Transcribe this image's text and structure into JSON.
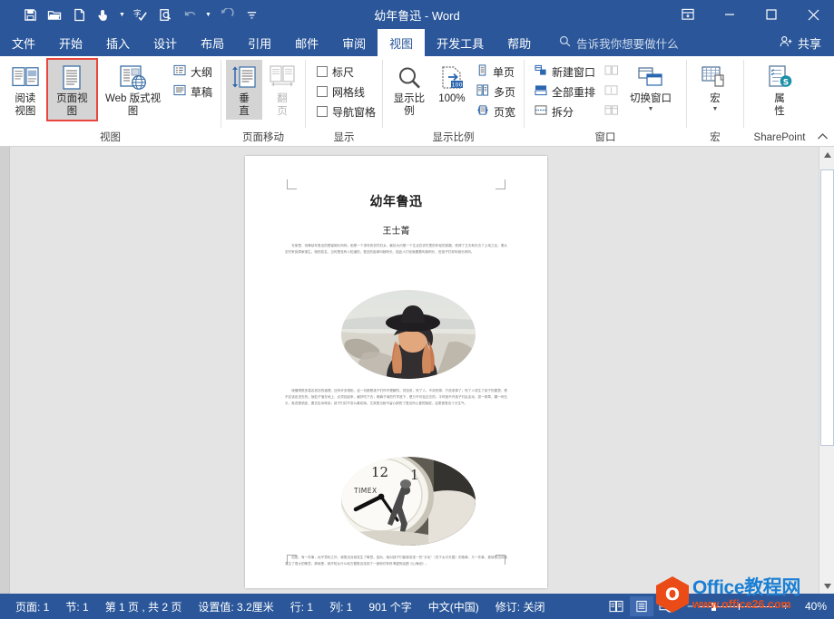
{
  "window": {
    "title": "幼年鲁迅  -  Word",
    "quick_access": [
      {
        "name": "save-icon",
        "label": "保存"
      },
      {
        "name": "open-icon",
        "label": "打开"
      },
      {
        "name": "new-document-icon",
        "label": "新建"
      },
      {
        "name": "touch-mode-icon",
        "label": "触摸/鼠标模式"
      },
      {
        "name": "spelling-check-icon",
        "label": "拼写和语法"
      },
      {
        "name": "print-preview-icon",
        "label": "打印预览和打印"
      },
      {
        "name": "undo-icon",
        "label": "撤消"
      },
      {
        "name": "redo-icon",
        "label": "恢复"
      },
      {
        "name": "customize-qat-icon",
        "label": "自定义快速访问工具栏"
      }
    ],
    "controls": [
      {
        "name": "ribbon-display-options-icon",
        "label": "功能区显示选项"
      },
      {
        "name": "minimize-icon",
        "label": "最小化"
      },
      {
        "name": "maximize-icon",
        "label": "最大化"
      },
      {
        "name": "close-icon",
        "label": "关闭"
      }
    ]
  },
  "tabs": [
    {
      "label": "文件",
      "active": false
    },
    {
      "label": "开始",
      "active": false
    },
    {
      "label": "插入",
      "active": false
    },
    {
      "label": "设计",
      "active": false
    },
    {
      "label": "布局",
      "active": false
    },
    {
      "label": "引用",
      "active": false
    },
    {
      "label": "邮件",
      "active": false
    },
    {
      "label": "审阅",
      "active": false
    },
    {
      "label": "视图",
      "active": true
    },
    {
      "label": "开发工具",
      "active": false
    },
    {
      "label": "帮助",
      "active": false
    }
  ],
  "tell_me": {
    "icon": "search-icon",
    "placeholder": "告诉我你想要做什么"
  },
  "share": {
    "icon": "share-person-icon",
    "label": "共享"
  },
  "ribbon": {
    "groups": [
      {
        "name": "视图",
        "label": "视图",
        "buttons": [
          {
            "label": "阅读\n视图",
            "label_l1": "阅读",
            "label_l2": "视图",
            "icon": "read-mode-icon",
            "state": "normal"
          },
          {
            "label": "页面视图",
            "label_l1": "页面视图",
            "label_l2": "",
            "icon": "print-layout-icon",
            "state": "selected-highlighted"
          },
          {
            "label": "Web 版式视图",
            "label_l1": "Web 版式视图",
            "label_l2": "",
            "icon": "web-layout-icon",
            "state": "normal"
          }
        ],
        "small_items": [
          {
            "label": "大纲",
            "icon": "outline-view-icon"
          },
          {
            "label": "草稿",
            "icon": "draft-view-icon"
          }
        ]
      },
      {
        "name": "页面移动",
        "label": "页面移动",
        "buttons": [
          {
            "label_l1": "垂",
            "label_l2": "直",
            "icon": "vertical-scroll-icon",
            "state": "selected"
          },
          {
            "label_l1": "翻",
            "label_l2": "页",
            "icon": "side-to-side-icon",
            "state": "disabled"
          }
        ]
      },
      {
        "name": "显示",
        "label": "显示",
        "checkboxes": [
          {
            "label": "标尺",
            "checked": false
          },
          {
            "label": "网格线",
            "checked": false
          },
          {
            "label": "导航窗格",
            "checked": false
          }
        ]
      },
      {
        "name": "显示比例",
        "label": "显示比例",
        "buttons": [
          {
            "label_l1": "显示比例",
            "label_l2": "",
            "icon": "zoom-magnifier-icon",
            "state": "normal"
          },
          {
            "label_l1": "100%",
            "label_l2": "",
            "icon": "zoom-100-icon",
            "state": "normal"
          }
        ],
        "small_items": [
          {
            "label": "单页",
            "icon": "one-page-icon"
          },
          {
            "label": "多页",
            "icon": "multiple-pages-icon"
          },
          {
            "label": "页宽",
            "icon": "page-width-icon"
          }
        ]
      },
      {
        "name": "窗口",
        "label": "窗口",
        "small_items": [
          {
            "label": "新建窗口",
            "icon": "new-window-icon"
          },
          {
            "label": "全部重排",
            "icon": "arrange-all-icon"
          },
          {
            "label": "拆分",
            "icon": "split-icon"
          }
        ],
        "small_items_disabled": [
          {
            "label": "",
            "icon": "view-side-by-side-icon"
          },
          {
            "label": "",
            "icon": "synchronous-scrolling-icon"
          },
          {
            "label": "",
            "icon": "reset-window-position-icon"
          }
        ],
        "buttons": [
          {
            "label_l1": "切换窗口",
            "label_l2": "",
            "icon": "switch-windows-icon",
            "state": "dropdown"
          }
        ]
      },
      {
        "name": "宏",
        "label": "宏",
        "buttons": [
          {
            "label_l1": "宏",
            "label_l2": "",
            "icon": "macros-icon",
            "state": "dropdown"
          }
        ]
      },
      {
        "name": "SharePoint",
        "label": "SharePoint",
        "buttons": [
          {
            "label_l1": "属",
            "label_l2": "性",
            "icon": "sharepoint-properties-icon",
            "state": "normal"
          }
        ]
      }
    ],
    "collapse_icon": "chevron-up-icon"
  },
  "document": {
    "title": "幼年鲁迅",
    "author": "王士菁",
    "paragraph_1": "在家里，侍奉幼年鲁迅的是保姆长妈妈。她是一个淳朴的农村妇女，最初大约是一个生活在农村里的年轻的孤孀，死掉了丈夫和夫去了土地之后，便从农村来到周家谋生。她的姓名，当时是没有人知道的，鲁迅的祖母叫她阿长，因此人们也就跟着叫她阿长，但孩子们却叫她长妈妈。",
    "paragraph_2": "她懂得很多莫名其妙的道理，还有许多规矩，这一切都是孩子们所不理解的。譬如说，死了人，不说死掉，只说老掉了；死了人或生了孩子的屋里，是不应该走进去的；饭粒子落在地上，必须捡起来，最好吃下去；晒裤子用的竹竿底下，是万不可钻过去的。平时她不许孩子们乱走动，拔一株草，翻一块石头，就说是顽皮，要去告诉母亲；孩子们并不怎么喜欢她。尤其是当她不留心踩死了鲁迅所心爱的隐鼠，这更使鲁迅十分生气。",
    "paragraph_3": "但是，有一件事，似乎意料之外，使鲁迅对她发生了敬意。因为，她对孩子们能够讲述一些“长毛”（关于太平天国）的故事，又一件事，更使鲁迅对她发生了很大的敬意。那就是，她不知从什么地方替鲁迅找到了一部他们有所渴望的绘图《山海经》。",
    "images": [
      {
        "name": "oval-photo-woman-beach",
        "alt": "戴黑帽的女子海边背影（椭圆裁剪）"
      },
      {
        "name": "oval-photo-timex-clock",
        "alt": "TIMEX 闹钟特写（椭圆裁剪）"
      }
    ]
  },
  "status_bar": {
    "items": [
      {
        "name": "page-indicator",
        "label": "页面: 1"
      },
      {
        "name": "section-indicator",
        "label": "节: 1"
      },
      {
        "name": "page-count",
        "label": "第 1 页 , 共 2 页"
      },
      {
        "name": "measurement-value",
        "label": "设置值: 3.2厘米"
      },
      {
        "name": "line-indicator",
        "label": "行: 1"
      },
      {
        "name": "column-indicator",
        "label": "列: 1"
      },
      {
        "name": "word-count",
        "label": "901 个字"
      },
      {
        "name": "language",
        "label": "中文(中国)"
      },
      {
        "name": "track-changes",
        "label": "修订: 关闭"
      }
    ],
    "view_buttons": [
      {
        "name": "read-mode-view-button",
        "icon": "read-mode-small-icon",
        "active": false
      },
      {
        "name": "print-layout-view-button",
        "icon": "print-layout-small-icon",
        "active": true
      },
      {
        "name": "web-layout-view-button",
        "icon": "web-layout-small-icon",
        "active": false
      }
    ],
    "zoom": {
      "out_label": "−",
      "in_label": "+",
      "percent": "40%"
    }
  },
  "watermark": {
    "logo_letter": "O",
    "line1": "Office教程网",
    "line2": "www.office26.com"
  },
  "colors": {
    "brand_blue": "#2b579a",
    "selection_red": "#e8453c",
    "ribbon_bg": "#ffffff",
    "canvas_gray": "#e4e4e4",
    "watermark_orange": "#eb4b17",
    "watermark_blue": "#1a7fd4"
  }
}
